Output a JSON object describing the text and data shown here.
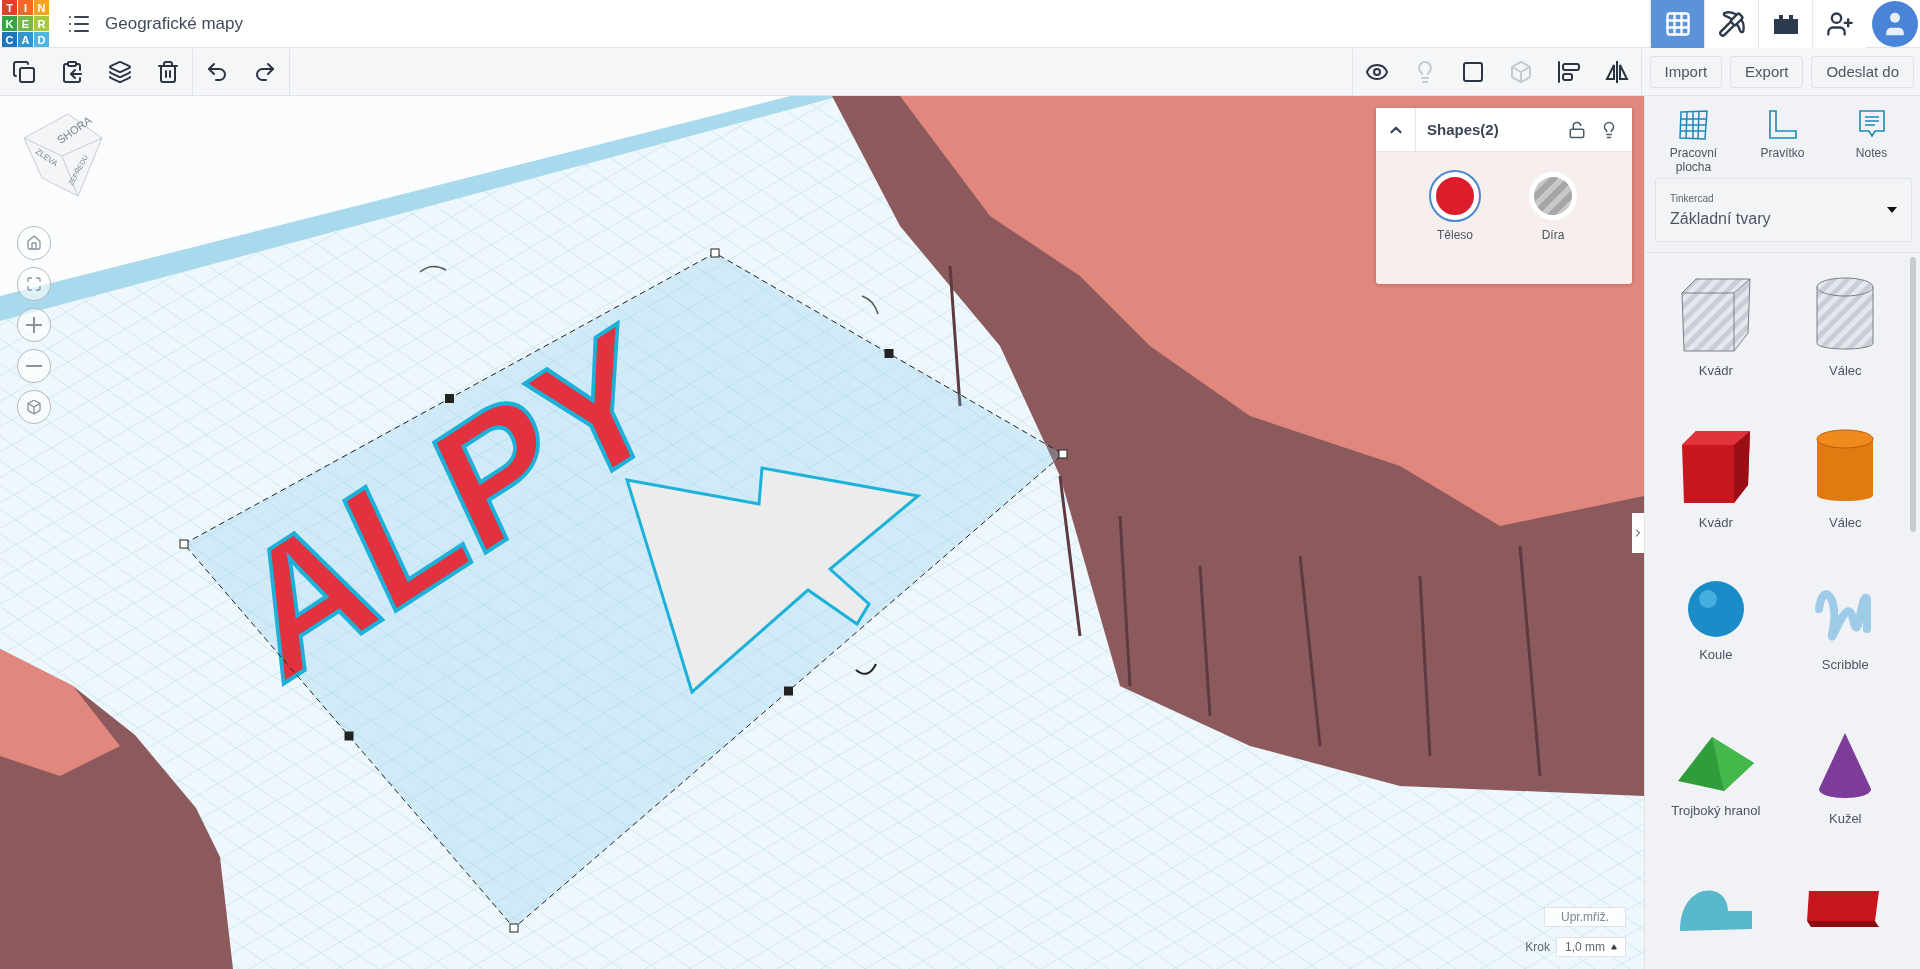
{
  "logo": [
    {
      "letter": "T",
      "color": "#e2402b"
    },
    {
      "letter": "I",
      "color": "#f26a21"
    },
    {
      "letter": "N",
      "color": "#f9a21a"
    },
    {
      "letter": "K",
      "color": "#37a447"
    },
    {
      "letter": "E",
      "color": "#77b843"
    },
    {
      "letter": "R",
      "color": "#a5c93a"
    },
    {
      "letter": "C",
      "color": "#1f74b8"
    },
    {
      "letter": "A",
      "color": "#2e97d3"
    },
    {
      "letter": "D",
      "color": "#4fb5e3"
    }
  ],
  "project": {
    "title": "Geografické mapy"
  },
  "views": [
    {
      "kind": "grid",
      "selected": true
    },
    {
      "kind": "pickaxe",
      "selected": false
    },
    {
      "kind": "bricks",
      "selected": false
    }
  ],
  "toolbar": {
    "edit_tools": [
      {
        "kind": "copy"
      },
      {
        "kind": "paste"
      },
      {
        "kind": "duplicate"
      },
      {
        "kind": "delete"
      },
      {
        "kind": "undo"
      },
      {
        "kind": "redo"
      }
    ],
    "view_tools": [
      {
        "kind": "notes-view",
        "disabled": false
      },
      {
        "kind": "light",
        "disabled": true
      },
      {
        "kind": "group",
        "disabled": false
      },
      {
        "kind": "ungroup",
        "disabled": true
      },
      {
        "kind": "align",
        "disabled": false
      },
      {
        "kind": "mirror",
        "disabled": false
      }
    ],
    "buttons": [
      "Import",
      "Export",
      "Odeslat do"
    ]
  },
  "view_cube": {
    "top": "SHORA",
    "left": "ZLEVA",
    "front": "ZEPŘEDU"
  },
  "nav_buttons": [
    {
      "kind": "home"
    },
    {
      "kind": "fit"
    },
    {
      "kind": "zoom-in"
    },
    {
      "kind": "zoom-out"
    },
    {
      "kind": "perspective"
    }
  ],
  "scene": {
    "text_shape": "ALPY"
  },
  "inspector": {
    "title": "Shapes(2)",
    "locked": false,
    "options": [
      {
        "label": "Těleso",
        "kind": "solid",
        "selected": true
      },
      {
        "label": "Díra",
        "kind": "hole",
        "selected": false
      }
    ]
  },
  "grid_controls": {
    "edit_grid": "Upr.mřiž.",
    "step_label": "Krok",
    "step_value": "1,0 mm"
  },
  "panel": {
    "tools": [
      {
        "kind": "workplane",
        "label": "Pracovní plocha"
      },
      {
        "kind": "ruler",
        "label": "Pravítko"
      },
      {
        "kind": "notes",
        "label": "Notes"
      }
    ],
    "library": {
      "source": "Tinkercad",
      "value": "Základní tvary"
    },
    "shapes": [
      {
        "kind": "box-hole",
        "label": "Kvádr"
      },
      {
        "kind": "cylinder-hole",
        "label": "Válec"
      },
      {
        "kind": "box",
        "label": "Kvádr"
      },
      {
        "kind": "cylinder",
        "label": "Válec"
      },
      {
        "kind": "sphere",
        "label": "Koule"
      },
      {
        "kind": "scribble",
        "label": "Scribble"
      },
      {
        "kind": "roof",
        "label": "Trojboký hranol"
      },
      {
        "kind": "cone",
        "label": "Kužel"
      },
      {
        "kind": "round-roof"
      },
      {
        "kind": "text"
      }
    ]
  }
}
